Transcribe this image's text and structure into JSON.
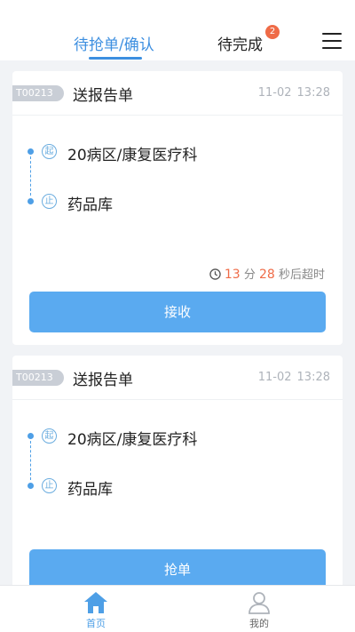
{
  "tabs": {
    "pending": "待抢单/确认",
    "todo": "待完成",
    "todo_badge": "2"
  },
  "orders": [
    {
      "id": "T00213",
      "type": "送报告单",
      "date": "11-02",
      "time": "13:28",
      "start_marker": "起",
      "from": "20病区/康复医疗科",
      "end_marker": "止",
      "to": "药品库",
      "timer": {
        "minutes": "13",
        "min_unit": "分",
        "seconds": "28",
        "suffix": "秒后超时"
      },
      "action": "接收"
    },
    {
      "id": "T00213",
      "type": "送报告单",
      "date": "11-02",
      "time": "13:28",
      "start_marker": "起",
      "from": "20病区/康复医疗科",
      "end_marker": "止",
      "to": "药品库",
      "action": "抢单"
    }
  ],
  "nav": {
    "home": "首页",
    "mine": "我的"
  },
  "colors": {
    "accent": "#3d8fe0",
    "button": "#5aaaf0",
    "alert": "#ef6b47"
  }
}
